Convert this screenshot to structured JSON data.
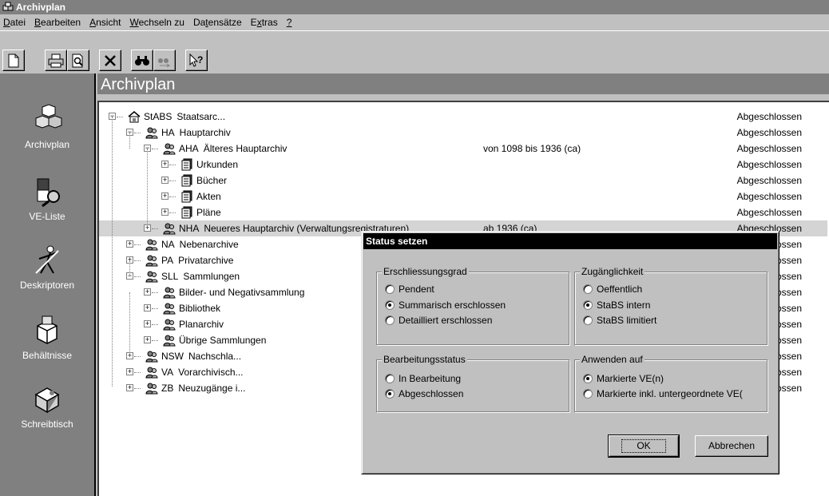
{
  "window": {
    "title": "Archivplan"
  },
  "menu": [
    {
      "label": "Datei",
      "acc": "D",
      "rest": "atei"
    },
    {
      "label": "Bearbeiten",
      "acc": "B",
      "rest": "earbeiten"
    },
    {
      "label": "Ansicht",
      "acc": "A",
      "rest": "nsicht"
    },
    {
      "label": "Wechseln zu",
      "acc": "W",
      "rest": "echseln zu"
    },
    {
      "label": "Datensätze",
      "pre": "Da",
      "acc": "t",
      "rest": "ensätze"
    },
    {
      "label": "Extras",
      "pre": "E",
      "acc": "x",
      "rest": "tras"
    },
    {
      "label": "?",
      "acc": "?",
      "rest": ""
    }
  ],
  "toolbar": {
    "icons": [
      "new-document-icon",
      "print-icon",
      "print-preview-icon",
      "delete-icon",
      "find-icon",
      "find-next-icon",
      "context-help-icon"
    ]
  },
  "sidebar": {
    "items": [
      {
        "label": "Archivplan",
        "icon": "archive-cubes-icon"
      },
      {
        "label": "VE-Liste",
        "icon": "list-search-icon"
      },
      {
        "label": "Deskriptoren",
        "icon": "descriptor-figure-icon"
      },
      {
        "label": "Behältnisse",
        "icon": "container-box-icon"
      },
      {
        "label": "Schreibtisch",
        "icon": "desk-icon"
      }
    ]
  },
  "main": {
    "title": "Archivplan"
  },
  "tree": {
    "rows": [
      {
        "code": "StABS",
        "name": "Staatsarc...",
        "range": "",
        "status": "Abgeschlossen",
        "level": 0,
        "expander": "minus",
        "icon": "house-icon"
      },
      {
        "code": "HA",
        "name": "Hauptarchiv",
        "range": "",
        "status": "Abgeschlossen",
        "level": 1,
        "expander": "minus",
        "icon": "folder-people-icon"
      },
      {
        "code": "AHA",
        "name": "Älteres Hauptarchiv",
        "range": "von 1098 bis 1936 (ca)",
        "status": "Abgeschlossen",
        "level": 2,
        "expander": "minus",
        "icon": "folder-people-icon"
      },
      {
        "code": "",
        "name": "Urkunden",
        "range": "",
        "status": "Abgeschlossen",
        "level": 3,
        "expander": "plus",
        "icon": "document-stack-icon"
      },
      {
        "code": "",
        "name": "Bücher",
        "range": "",
        "status": "Abgeschlossen",
        "level": 3,
        "expander": "plus",
        "icon": "document-stack-icon"
      },
      {
        "code": "",
        "name": "Akten",
        "range": "",
        "status": "Abgeschlossen",
        "level": 3,
        "expander": "plus",
        "icon": "document-stack-icon"
      },
      {
        "code": "",
        "name": "Pläne",
        "range": "",
        "status": "Abgeschlossen",
        "level": 3,
        "expander": "plus",
        "icon": "document-stack-icon"
      },
      {
        "code": "NHA",
        "name": "Neueres Hauptarchiv (Verwaltungsregistraturen)",
        "range": "ab 1936 (ca)",
        "status": "Abgeschlossen",
        "level": 2,
        "expander": "plus",
        "icon": "folder-people-icon",
        "selected": true
      },
      {
        "code": "NA",
        "name": "Nebenarchive",
        "range": "",
        "status": "Abgeschlossen",
        "level": 1,
        "expander": "plus",
        "icon": "folder-people-icon"
      },
      {
        "code": "PA",
        "name": "Privatarchive",
        "range": "",
        "status": "Abgeschlossen",
        "level": 1,
        "expander": "plus",
        "icon": "folder-people-icon"
      },
      {
        "code": "SLL",
        "name": "Sammlungen",
        "range": "",
        "status": "Abgeschlossen",
        "level": 1,
        "expander": "minus",
        "icon": "folder-people-icon"
      },
      {
        "code": "",
        "name": "Bilder- und Negativsammlung",
        "range": "",
        "status": "Abgeschlossen",
        "level": 2,
        "expander": "plus",
        "icon": "folder-people-icon"
      },
      {
        "code": "",
        "name": "Bibliothek",
        "range": "",
        "status": "Abgeschlossen",
        "level": 2,
        "expander": "plus",
        "icon": "folder-people-icon"
      },
      {
        "code": "",
        "name": "Planarchiv",
        "range": "",
        "status": "Abgeschlossen",
        "level": 2,
        "expander": "plus",
        "icon": "folder-people-icon"
      },
      {
        "code": "",
        "name": "Übrige Sammlungen",
        "range": "",
        "status": "Abgeschlossen",
        "level": 2,
        "expander": "plus",
        "icon": "folder-people-icon"
      },
      {
        "code": "NSW",
        "name": "Nachschla...",
        "range": "",
        "status": "Abgeschlossen",
        "level": 1,
        "expander": "plus",
        "icon": "folder-people-icon"
      },
      {
        "code": "VA",
        "name": "Vorarchivisch...",
        "range": "",
        "status": "Abgeschlossen",
        "level": 1,
        "expander": "plus",
        "icon": "folder-people-icon"
      },
      {
        "code": "ZB",
        "name": "Neuzugänge i...",
        "range": "",
        "status": "Abgeschlossen",
        "level": 1,
        "expander": "plus",
        "icon": "folder-people-icon"
      }
    ]
  },
  "dialog": {
    "title": "Status setzen",
    "groups": {
      "erschliessung": {
        "label": "Erschliessungsgrad",
        "options": [
          "Pendent",
          "Summarisch erschlossen",
          "Detailliert erschlossen"
        ],
        "selected": 1
      },
      "zugang": {
        "label": "Zugänglichkeit",
        "options": [
          "Oeffentlich",
          "StaBS intern",
          "StaBS limitiert"
        ],
        "selected": 1
      },
      "bearbeitung": {
        "label": "Bearbeitungsstatus",
        "options": [
          "In Bearbeitung",
          "Abgeschlossen"
        ],
        "selected": 1
      },
      "anwenden": {
        "label": "Anwenden auf",
        "options": [
          "Markierte VE(n)",
          "Markierte inkl. untergeordnete VE("
        ],
        "selected": 0
      }
    },
    "ok_label": "OK",
    "cancel_label": "Abbrechen"
  },
  "colors": {
    "titlebar": "#808080",
    "sidebar": "#808080",
    "dialog_title": "#000000",
    "face": "#c0c0c0",
    "selection": "#d4d4d4"
  }
}
